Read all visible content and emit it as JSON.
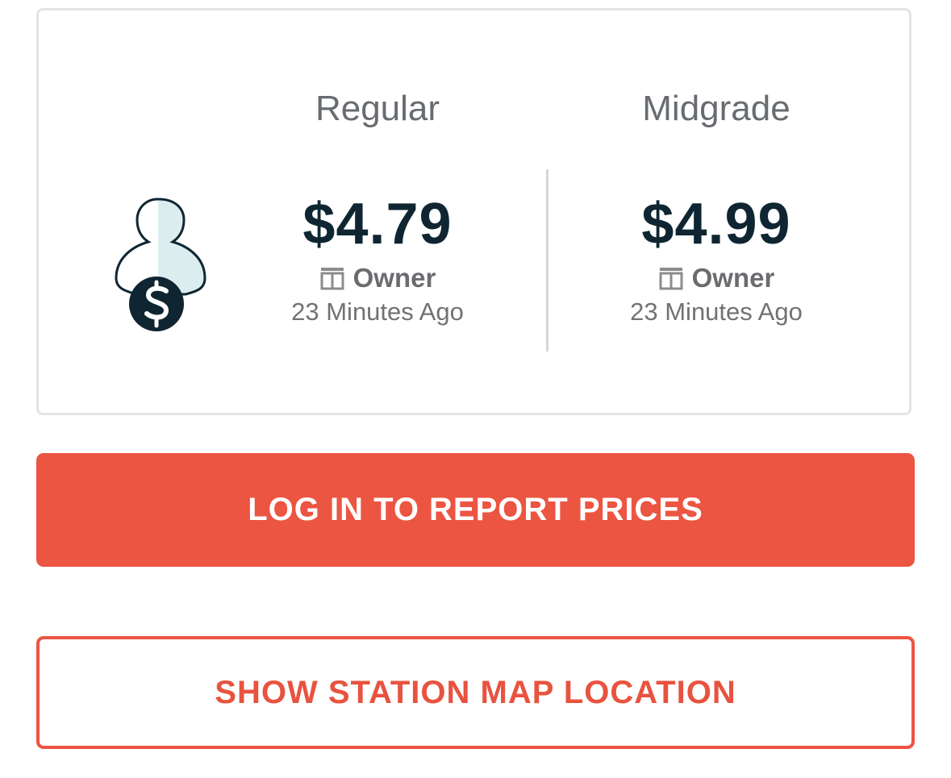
{
  "prices": [
    {
      "grade": "Regular",
      "price": "$4.79",
      "source": "Owner",
      "time_ago": "23 Minutes Ago"
    },
    {
      "grade": "Midgrade",
      "price": "$4.99",
      "source": "Owner",
      "time_ago": "23 Minutes Ago"
    }
  ],
  "icons": {
    "avatar": "owner-dollar-icon",
    "source": "owner-source-icon"
  },
  "actions": {
    "login_label": "LOG IN TO REPORT PRICES",
    "map_label": "SHOW STATION MAP LOCATION"
  },
  "colors": {
    "accent": "#ec5542",
    "price_text": "#0f2632",
    "muted_text": "#6a6c6f",
    "avatar_fill": "#dcedf0"
  }
}
